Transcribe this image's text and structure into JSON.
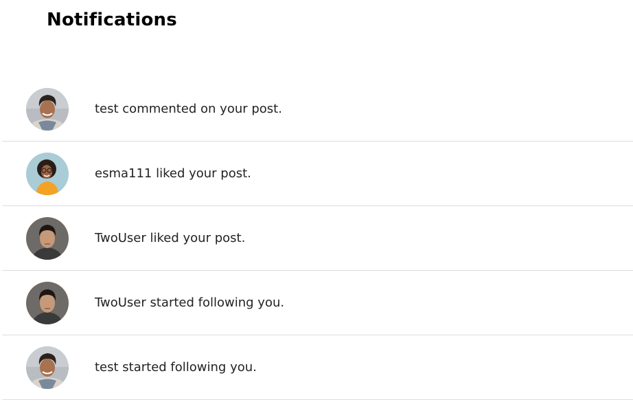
{
  "header": {
    "title": "Notifications"
  },
  "notifications": [
    {
      "text": "test commented on your post.",
      "avatar": "avatar-man-curly-hair"
    },
    {
      "text": "esma111 liked your post.",
      "avatar": "avatar-woman-yellow-top"
    },
    {
      "text": "TwoUser liked your post.",
      "avatar": "avatar-man-dark"
    },
    {
      "text": "TwoUser started following you.",
      "avatar": "avatar-man-dark"
    },
    {
      "text": "test started following you.",
      "avatar": "avatar-man-curly-hair"
    }
  ]
}
